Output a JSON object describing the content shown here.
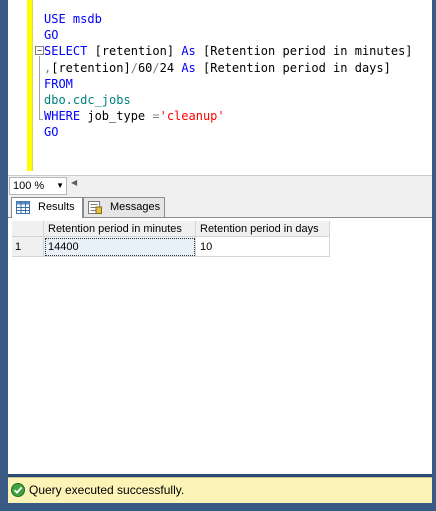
{
  "editor": {
    "lines": [
      "USE msdb",
      "GO",
      "SELECT [retention] As [Retention period in minutes]",
      ",[retention]/60/24 As [Retention period in days]",
      "FROM",
      "dbo.cdc_jobs",
      "WHERE job_type ='cleanup'",
      "GO"
    ]
  },
  "zoom": {
    "value": "100 %"
  },
  "tabs": [
    {
      "label": "Results",
      "icon": "grid-icon",
      "active": true
    },
    {
      "label": "Messages",
      "icon": "messages-icon",
      "active": false
    }
  ],
  "results": {
    "columns": [
      "Retention period in minutes",
      "Retention period in days"
    ],
    "rows": [
      {
        "num": "1",
        "cells": [
          "14400",
          "10"
        ]
      }
    ]
  },
  "status": {
    "text": "Query executed successfully.",
    "icon": "success-check-icon",
    "color": "#fbf4b6"
  }
}
